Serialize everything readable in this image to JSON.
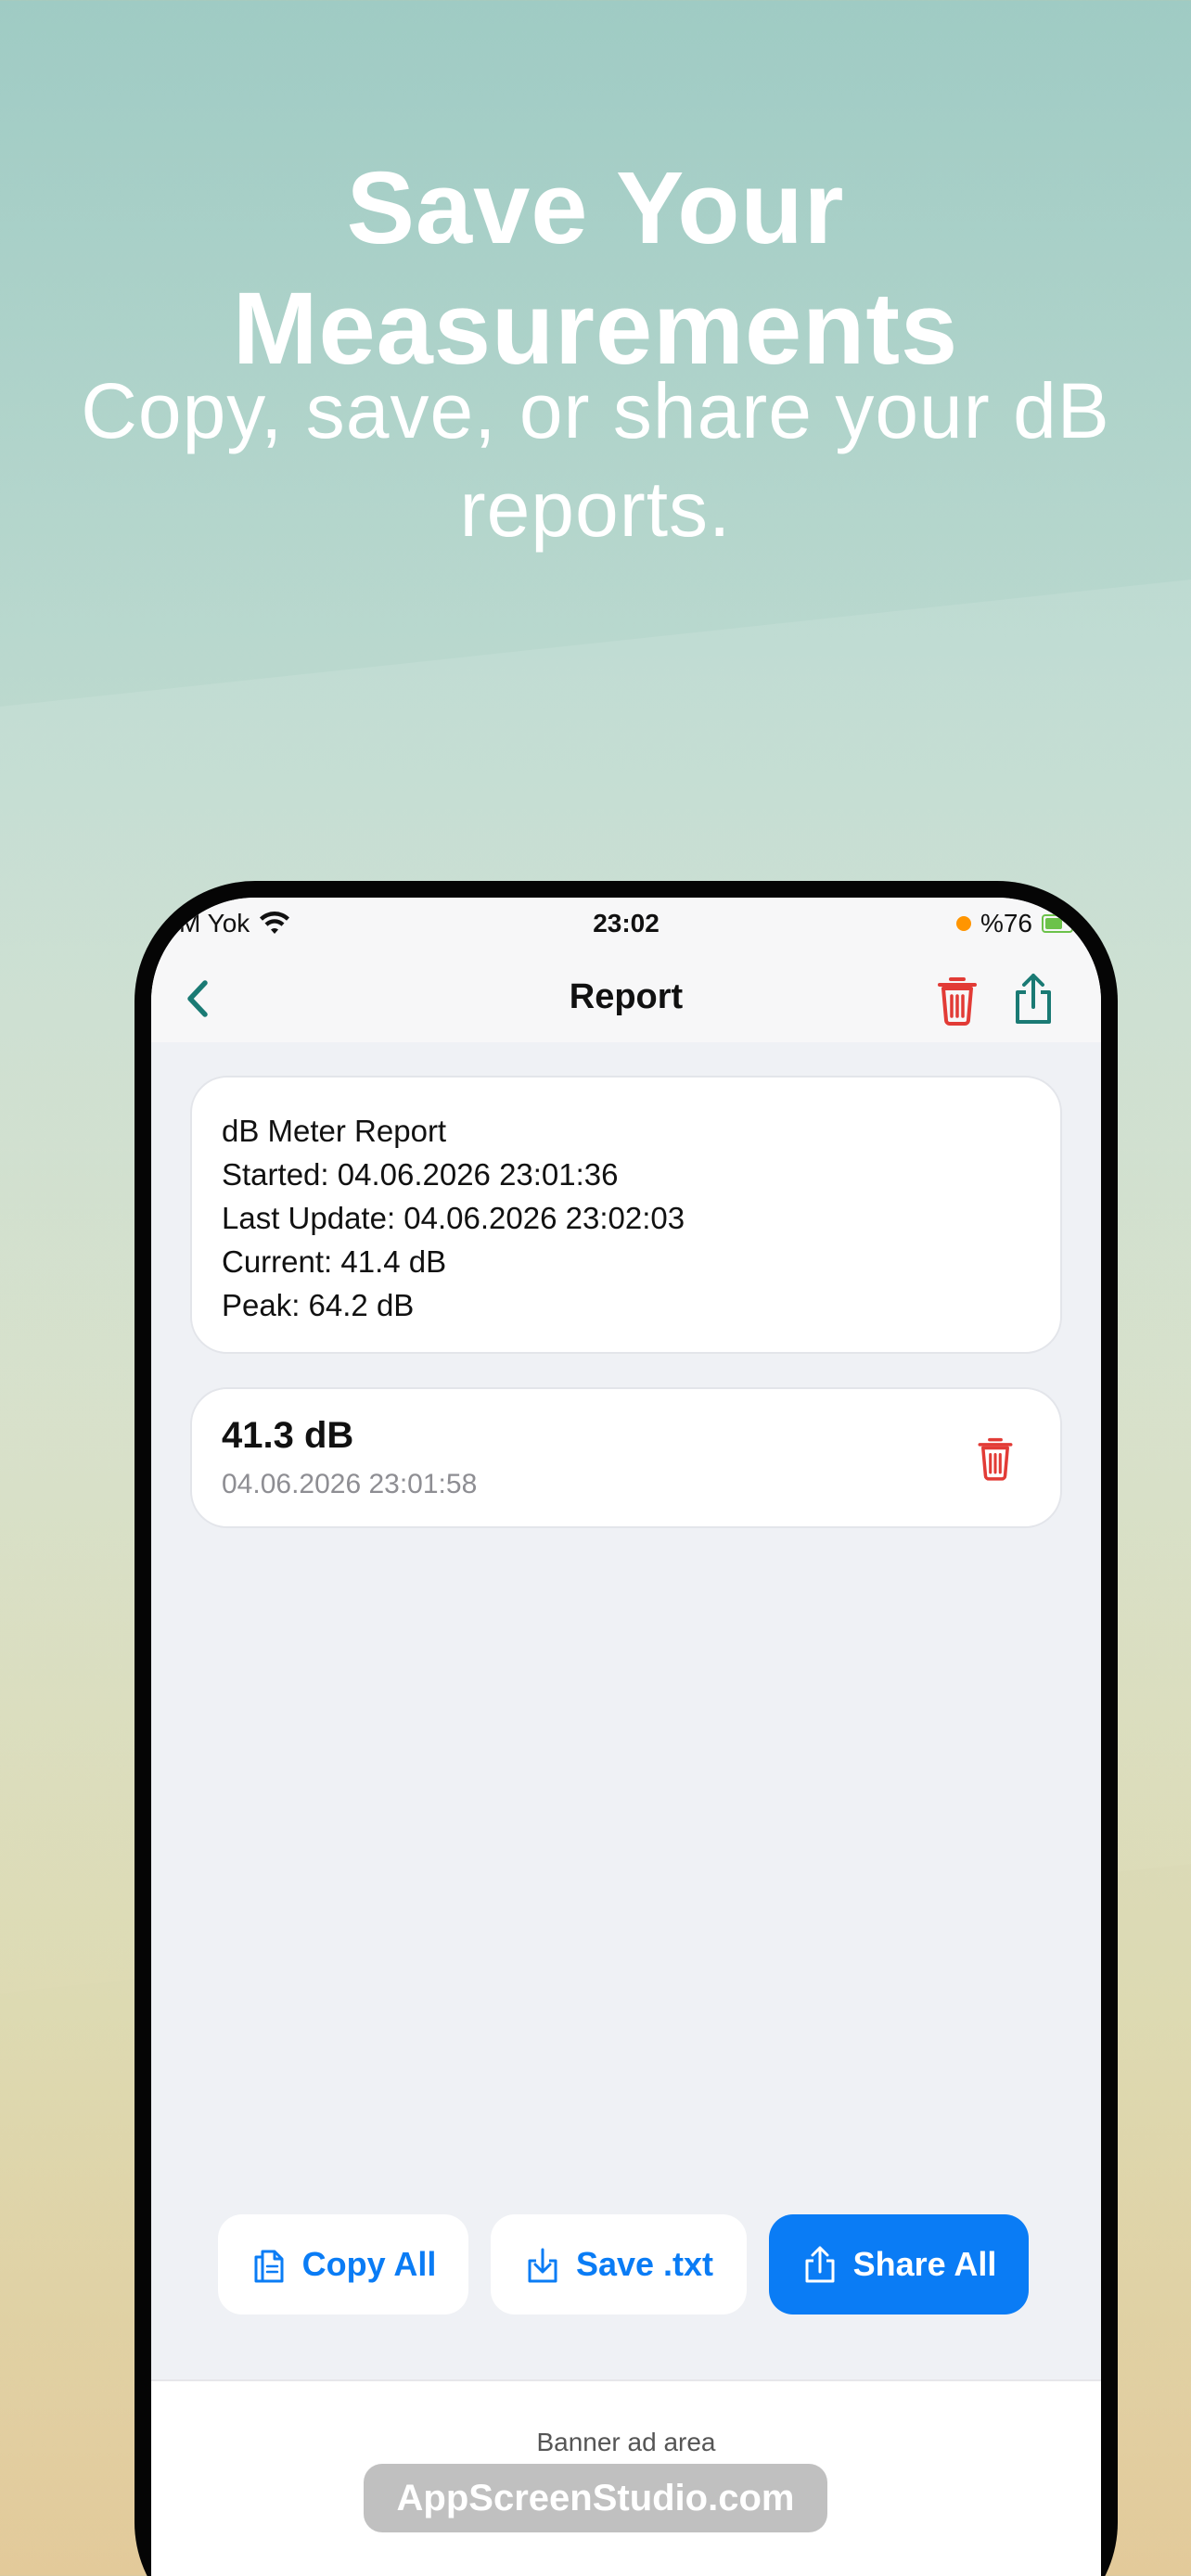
{
  "promo": {
    "headline": "Save Your Measurements",
    "subhead": "Copy, save, or share your dB reports."
  },
  "status_bar": {
    "carrier": "M Yok",
    "time": "23:02",
    "battery": "%76"
  },
  "nav": {
    "title": "Report",
    "back_icon": "chevron-left-icon",
    "trash_icon": "trash-icon",
    "share_icon": "share-icon"
  },
  "report": {
    "lines": [
      "dB Meter Report",
      "Started: 04.06.2026 23:01:36",
      "Last Update: 04.06.2026 23:02:03",
      "Current: 41.4 dB",
      "Peak: 64.2 dB"
    ]
  },
  "entries": [
    {
      "value": "41.3 dB",
      "time": "04.06.2026 23:01:58"
    }
  ],
  "actions": {
    "copy_label": "Copy All",
    "save_label": "Save .txt",
    "share_label": "Share All"
  },
  "banner": {
    "label": "Banner ad area"
  },
  "watermark": "AppScreenStudio.com",
  "colors": {
    "accent_blue": "#0a7cf5",
    "teal": "#1a7a74",
    "delete_red": "#e23b36"
  }
}
